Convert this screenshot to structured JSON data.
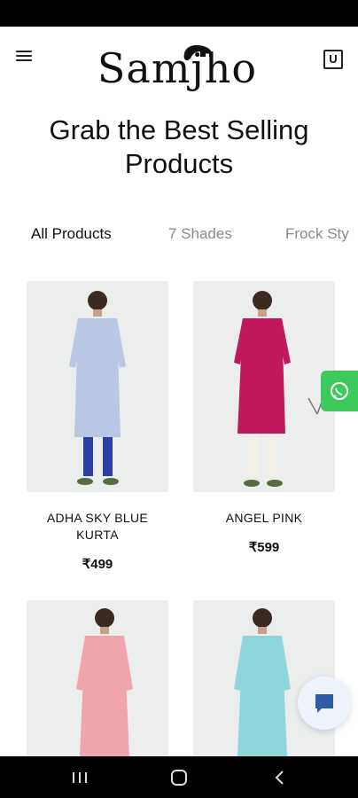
{
  "header": {
    "logo_text": "Samjho",
    "cart_glyph": "U",
    "menu_icon": "hamburger-icon",
    "cart_icon": "shopping-bag-icon"
  },
  "heading": "Grab the Best Selling Products",
  "tabs": [
    {
      "label": "All Products",
      "active": true
    },
    {
      "label": "7 Shades",
      "active": false
    },
    {
      "label": "Frock Sty",
      "active": false
    }
  ],
  "products": [
    {
      "name": "ADHA SKY BLUE KURTA",
      "price": "₹499",
      "dress_color": "#b9c6e4",
      "bottom_color": "#2a3fa1"
    },
    {
      "name": "ANGEL PINK",
      "price": "₹599",
      "dress_color": "#c2195c",
      "bottom_color": "#f2efe6"
    },
    {
      "name": "",
      "price": "",
      "dress_color": "#f0a4ae",
      "bottom_color": "#f0a4ae"
    },
    {
      "name": "",
      "price": "",
      "dress_color": "#8fd6dc",
      "bottom_color": "#8fd6dc"
    }
  ],
  "floating": {
    "whatsapp_icon": "whatsapp-icon",
    "chat_icon": "chat-bubble-icon",
    "whatsapp_color": "#3dc95b"
  },
  "nav": [
    "recent-apps-icon",
    "home-icon",
    "back-icon"
  ]
}
